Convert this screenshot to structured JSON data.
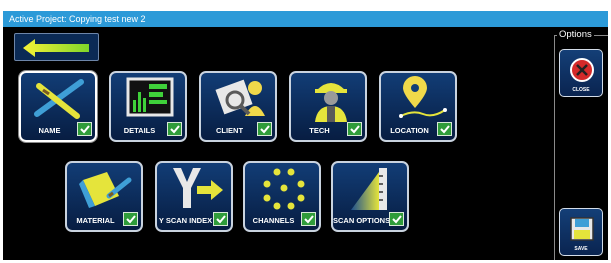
{
  "window": {
    "title": "Active Project: Copying test new 2"
  },
  "toolbar": {
    "back_icon": "back-arrow-icon"
  },
  "options": {
    "label": "Options",
    "close_label": "CLOSE",
    "save_label": "SAVE"
  },
  "tiles": [
    {
      "label": "NAME",
      "icon": "pencil-icon",
      "checked": true
    },
    {
      "label": "DETAILS",
      "icon": "details-monitor-icon",
      "checked": true
    },
    {
      "label": "CLIENT",
      "icon": "client-search-icon",
      "checked": true
    },
    {
      "label": "TECH",
      "icon": "technician-icon",
      "checked": true
    },
    {
      "label": "LOCATION",
      "icon": "location-pin-icon",
      "checked": true
    },
    {
      "label": "MATERIAL",
      "icon": "material-icon",
      "checked": true
    },
    {
      "label": "Y SCAN INDEX",
      "icon": "y-scan-index-icon",
      "checked": true
    },
    {
      "label": "CHANNELS",
      "icon": "channels-dots-icon",
      "checked": true
    },
    {
      "label": "SCAN OPTIONS",
      "icon": "scan-options-icon",
      "checked": true
    }
  ],
  "colors": {
    "title_bar": "#2c9ad8",
    "tile_bg": "#123d76",
    "check_green": "#2f9c3a",
    "accent_yellow": "#e8e83a"
  }
}
